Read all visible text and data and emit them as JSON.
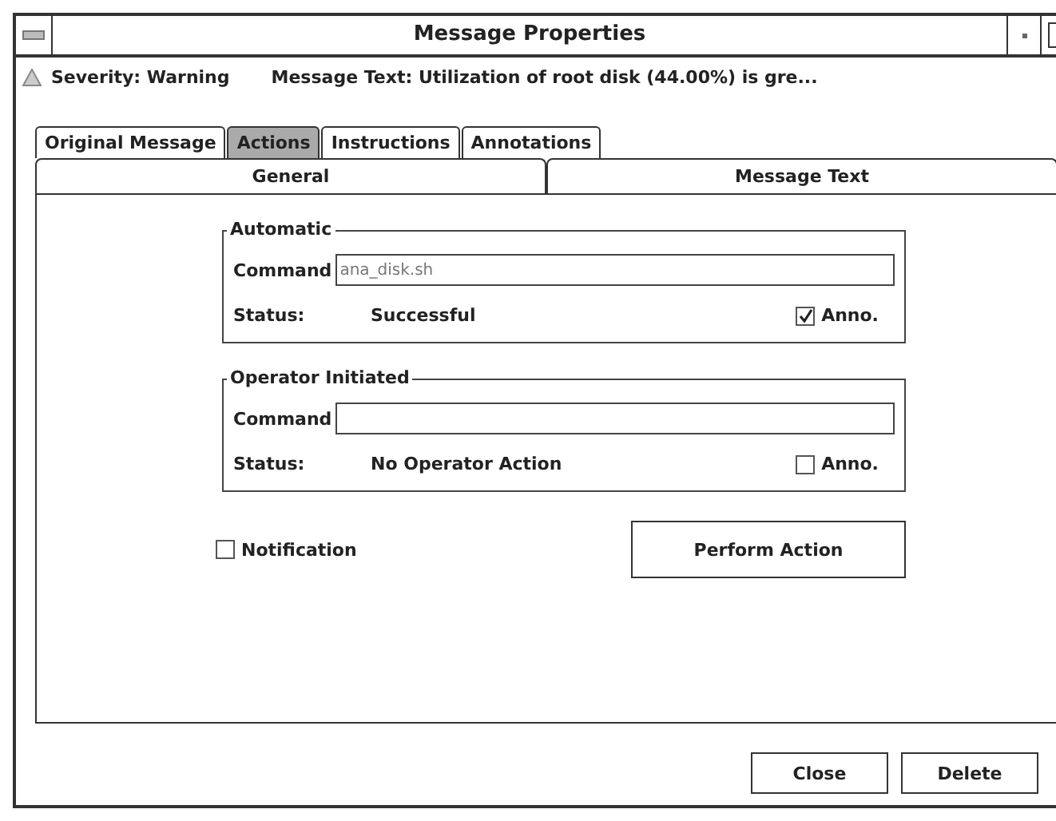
{
  "window": {
    "title": "Message Properties"
  },
  "header": {
    "severity": "Severity: Warning",
    "message_text": "Message Text: Utilization of root disk (44.00%) is gre..."
  },
  "tab_rows": [
    [
      {
        "label": "Original Message",
        "selected": false
      },
      {
        "label": "Actions",
        "selected": true
      },
      {
        "label": "Instructions",
        "selected": false
      },
      {
        "label": "Annotations",
        "selected": false
      }
    ],
    [
      {
        "label": "General",
        "selected": false
      },
      {
        "label": "Message Text",
        "selected": false
      }
    ]
  ],
  "groups": [
    {
      "title": "Automatic",
      "command_label": "Command",
      "command_value": "ana_disk.sh",
      "status_label": "Status:",
      "status": "Successful",
      "anno_label": "Anno.",
      "anno_checked": true
    },
    {
      "title": "Operator Initiated",
      "command_label": "Command",
      "status_label": "Status:",
      "status": "No Operator Action",
      "anno_label": "Anno.",
      "anno_checked": false
    }
  ],
  "notification": {
    "label": "Notification",
    "checked": false
  },
  "perform_button": "Perform Action",
  "buttons": [
    "Close",
    "Delete"
  ]
}
